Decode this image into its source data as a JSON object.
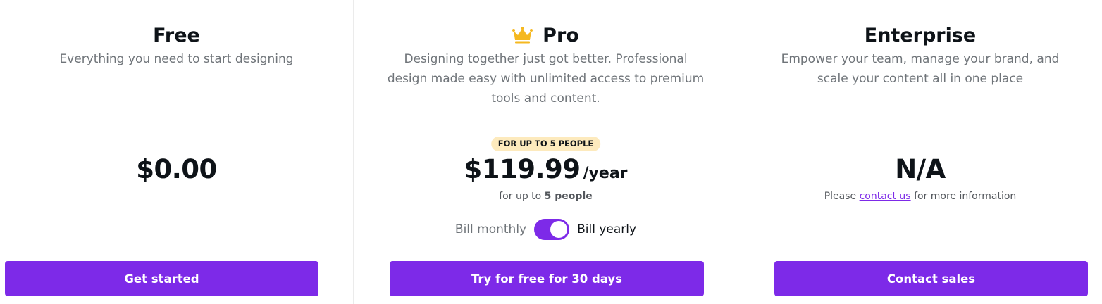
{
  "plans": {
    "free": {
      "title": "Free",
      "description": "Everything you need to start designing",
      "price": "$0.00",
      "cta": "Get started"
    },
    "pro": {
      "icon": "crown-icon",
      "title": "Pro",
      "description": "Designing together just got better. Professional design made easy with unlimited access to premium tools and content.",
      "badge": "FOR UP TO 5 PEOPLE",
      "price": "$119.99",
      "price_period": "/year",
      "note_prefix": "for up to",
      "note_people": "5 people",
      "billing_monthly": "Bill monthly",
      "billing_yearly": "Bill yearly",
      "billing_yearly_selected": true,
      "cta": "Try for free for 30 days"
    },
    "enterprise": {
      "title": "Enterprise",
      "description": "Empower your team, manage your brand, and scale your content all in one place",
      "price": "N/A",
      "note_prefix": "Please",
      "note_link": "contact us",
      "note_suffix": "for more information",
      "cta": "Contact sales"
    }
  },
  "colors": {
    "accent": "#7d2ae8",
    "badge_bg": "#fdeabd",
    "crown": "#f5b820",
    "text": "#0e1318",
    "muted_text": "#6f7479"
  }
}
